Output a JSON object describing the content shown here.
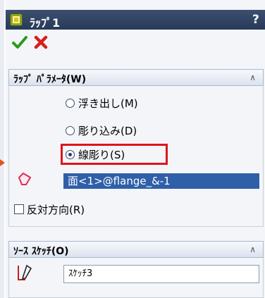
{
  "feature": {
    "title": "ﾗｯﾌﾟ1",
    "help_label": "?"
  },
  "buttons": {
    "ok_icon": "check-icon",
    "cancel_icon": "close-icon"
  },
  "wrap_parameters": {
    "header": "ﾗｯﾌﾟ ﾊﾟﾗﾒｰﾀ(W)",
    "options": [
      {
        "label": "浮き出し(M)",
        "selected": false
      },
      {
        "label": "彫り込み(D)",
        "selected": false
      },
      {
        "label": "線彫り(S)",
        "selected": true
      }
    ],
    "face_selection": "面<1>@flange_&-1",
    "reverse_direction_label": "反対方向(R)",
    "reverse_direction_checked": false
  },
  "source_sketch": {
    "header": "ｿｰｽ ｽｹｯﾁ(O)",
    "value": "ｽｹｯﾁ3"
  },
  "colors": {
    "title_bar": "#273a59",
    "highlight": "#e0141b",
    "selection": "#2f5fa8",
    "annotation_arrow": "#e6531f"
  }
}
